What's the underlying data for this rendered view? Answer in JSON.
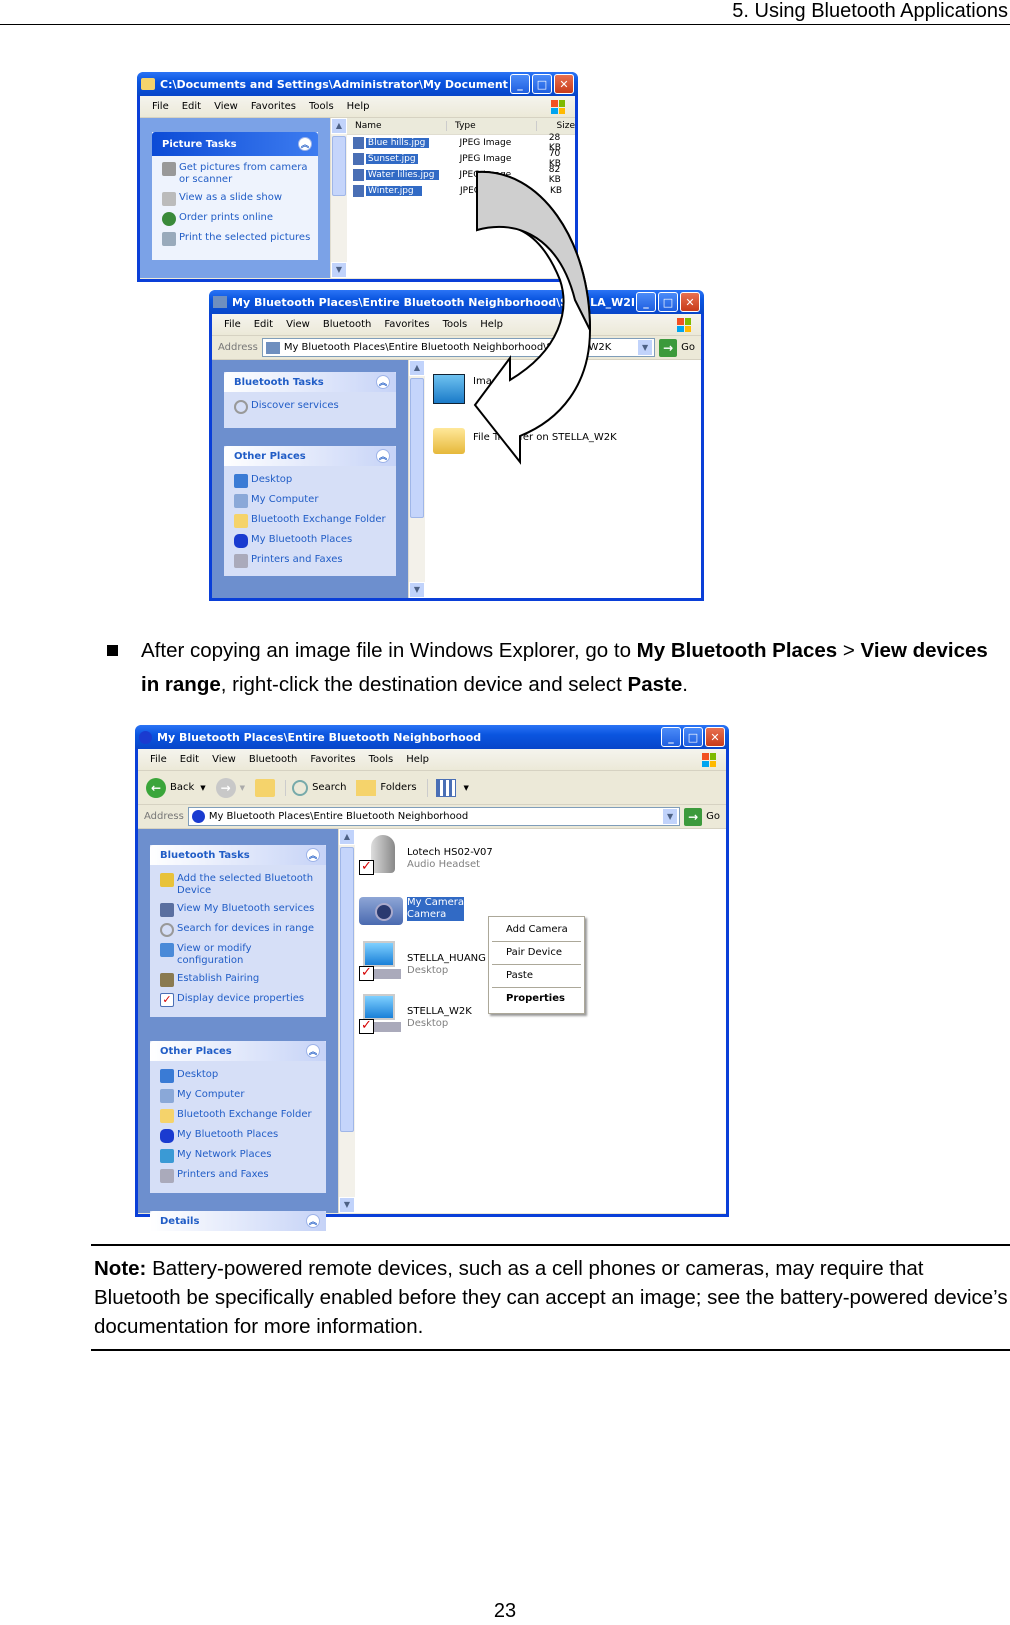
{
  "page": {
    "header": "5. Using Bluetooth Applications",
    "page_number": "23"
  },
  "window1": {
    "title": "C:\\Documents and Settings\\Administrator\\My Document...",
    "menu": [
      "File",
      "Edit",
      "View",
      "Favorites",
      "Tools",
      "Help"
    ],
    "task_panel": {
      "title": "Picture Tasks",
      "items": [
        "Get pictures from camera or scanner",
        "View as a slide show",
        "Order prints online",
        "Print the selected pictures"
      ]
    },
    "columns": [
      "Name",
      "Type",
      "Size"
    ],
    "files": [
      {
        "name": "Blue hills.jpg",
        "type": "JPEG Image",
        "size": "28 KB"
      },
      {
        "name": "Sunset.jpg",
        "type": "JPEG Image",
        "size": "70 KB"
      },
      {
        "name": "Water lilies.jpg",
        "type": "JPEG Image",
        "size": "82 KB"
      },
      {
        "name": "Winter.jpg",
        "type": "JPEG Image",
        "size": "KB"
      }
    ]
  },
  "window2": {
    "title": "My Bluetooth Places\\Entire Bluetooth Neighborhood\\STELLA_W2K",
    "menu": [
      "File",
      "Edit",
      "View",
      "Bluetooth",
      "Favorites",
      "Tools",
      "Help"
    ],
    "address_label": "Address",
    "address": "My Bluetooth Places\\Entire Bluetooth Neighborhood\\STELLA_W2K",
    "go_label": "Go",
    "bluetooth_tasks": {
      "title": "Bluetooth Tasks",
      "items": [
        "Discover services"
      ]
    },
    "other_places": {
      "title": "Other Places",
      "items": [
        "Desktop",
        "My Computer",
        "Bluetooth Exchange Folder",
        "My Bluetooth Places",
        "Printers and Faxes"
      ]
    },
    "services": [
      "Imaging on",
      "File Transfer on STELLA_W2K"
    ]
  },
  "instruction": {
    "text_1": "After copying an image file in Windows Explorer, go to ",
    "bold_1": "My Bluetooth Places",
    "text_2": " > ",
    "bold_2": "View devices in range",
    "text_3": ", right-click the destination device and select ",
    "bold_3": "Paste",
    "text_4": "."
  },
  "window3": {
    "title": "My Bluetooth Places\\Entire Bluetooth Neighborhood",
    "menu": [
      "File",
      "Edit",
      "View",
      "Bluetooth",
      "Favorites",
      "Tools",
      "Help"
    ],
    "toolbar": {
      "back": "Back",
      "search": "Search",
      "folders": "Folders"
    },
    "address_label": "Address",
    "address": "My Bluetooth Places\\Entire Bluetooth Neighborhood",
    "go_label": "Go",
    "bluetooth_tasks": {
      "title": "Bluetooth Tasks",
      "items": [
        "Add the selected Bluetooth Device",
        "View My Bluetooth services",
        "Search for devices in range",
        "View or modify configuration",
        "Establish Pairing",
        "Display device properties"
      ]
    },
    "other_places": {
      "title": "Other Places",
      "items": [
        "Desktop",
        "My Computer",
        "Bluetooth Exchange Folder",
        "My Bluetooth Places",
        "My Network Places",
        "Printers and Faxes"
      ]
    },
    "details_title": "Details",
    "devices": [
      {
        "name": "Lotech HS02-V07",
        "type": "Audio Headset"
      },
      {
        "name": "My Camera",
        "type": "Camera"
      },
      {
        "name": "STELLA_HUANG",
        "type": "Desktop"
      },
      {
        "name": "STELLA_W2K",
        "type": "Desktop"
      }
    ],
    "context_menu": [
      "Add Camera",
      "Pair Device",
      "Paste",
      "Properties"
    ]
  },
  "note": {
    "label": "Note:",
    "text": " Battery-powered remote devices, such as a cell phones or cameras, may require that Bluetooth be specifically enabled before they can accept an image; see the battery-powered device’s documentation for more information."
  }
}
